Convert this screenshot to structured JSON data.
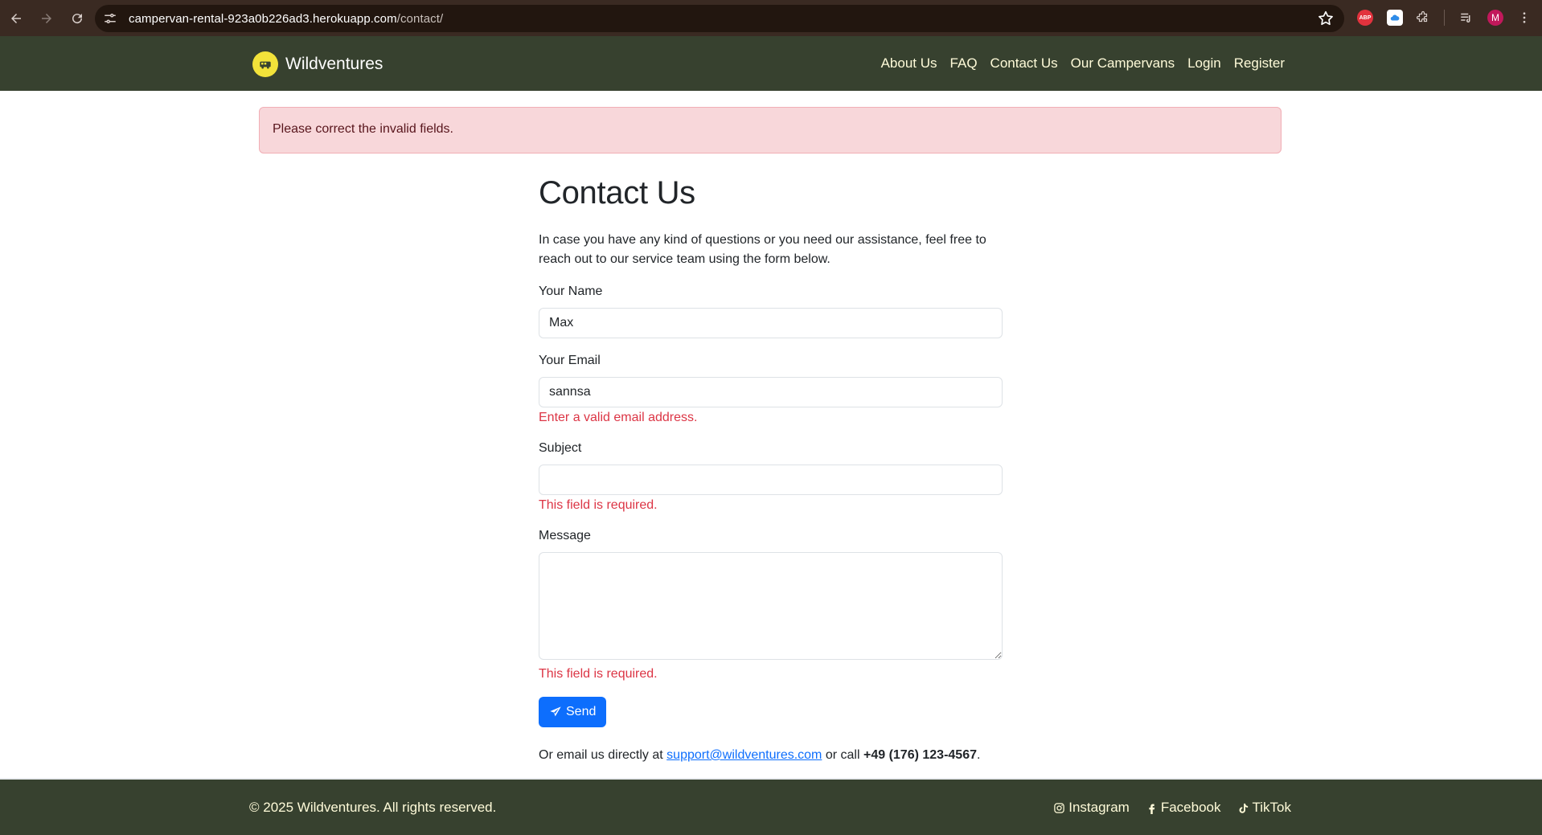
{
  "browser": {
    "url_host": "campervan-rental-923a0b226ad3.herokuapp.com",
    "url_path": "/contact/",
    "extension_abp": "ABP",
    "profile_initial": "M"
  },
  "navbar": {
    "brand": "Wildventures",
    "links": [
      "About Us",
      "FAQ",
      "Contact Us",
      "Our Campervans",
      "Login",
      "Register"
    ]
  },
  "alert": {
    "text": "Please correct the invalid fields."
  },
  "form": {
    "title": "Contact Us",
    "intro": "In case you have any kind of questions or you need our assistance, feel free to reach out to our service team using the form below.",
    "name_label": "Your Name",
    "name_value": "Max",
    "email_label": "Your Email",
    "email_value": "sannsa",
    "email_error": "Enter a valid email address.",
    "subject_label": "Subject",
    "subject_value": "",
    "subject_error": "This field is required.",
    "message_label": "Message",
    "message_value": "",
    "message_error": "This field is required.",
    "send_label": "Send"
  },
  "contact": {
    "prefix": "Or email us directly at",
    "email": "support@wildventures.com",
    "middle": "or call",
    "phone": "+49 (176) 123-4567",
    "suffix": "."
  },
  "footer": {
    "copyright": "© 2025 Wildventures. All rights reserved.",
    "social": [
      "Instagram",
      "Facebook",
      "TikTok"
    ]
  },
  "colors": {
    "nav_bg": "#37412f",
    "nav_text": "#fffbd9",
    "primary": "#0d6efd",
    "danger": "#dc3545",
    "alert_bg": "#f8d7da"
  }
}
